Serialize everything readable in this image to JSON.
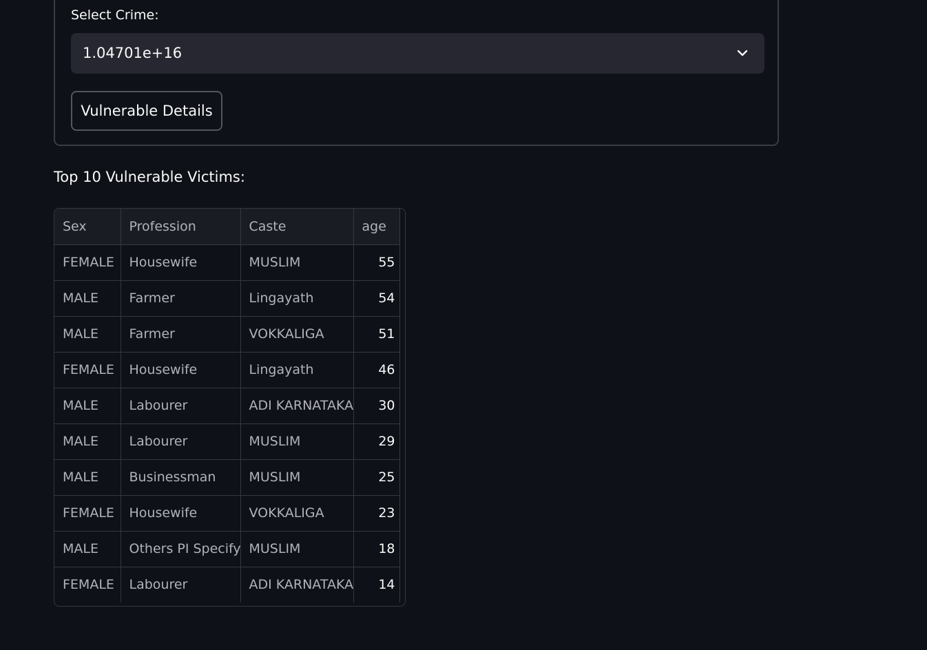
{
  "form": {
    "select_label": "Select Crime:",
    "select_value": "1.04701e+16",
    "button_label": "Vulnerable Details"
  },
  "results": {
    "title": "Top 10 Vulnerable Victims:",
    "columns": [
      "Sex",
      "Profession",
      "Caste",
      "age"
    ],
    "rows": [
      [
        "FEMALE",
        "Housewife",
        "MUSLIM",
        "55"
      ],
      [
        "MALE",
        "Farmer",
        "Lingayath",
        "54"
      ],
      [
        "MALE",
        "Farmer",
        "VOKKALIGA",
        "51"
      ],
      [
        "FEMALE",
        "Housewife",
        "Lingayath",
        "46"
      ],
      [
        "MALE",
        "Labourer",
        "ADI KARNATAKA",
        "30"
      ],
      [
        "MALE",
        "Labourer",
        "MUSLIM",
        "29"
      ],
      [
        "MALE",
        "Businessman",
        "MUSLIM",
        "25"
      ],
      [
        "FEMALE",
        "Housewife",
        "VOKKALIGA",
        "23"
      ],
      [
        "MALE",
        "Others PI Specify",
        "MUSLIM",
        "18"
      ],
      [
        "FEMALE",
        "Labourer",
        "ADI KARNATAKA",
        "14"
      ]
    ]
  },
  "icons": {
    "select_chevron": "chevron-down-icon"
  }
}
